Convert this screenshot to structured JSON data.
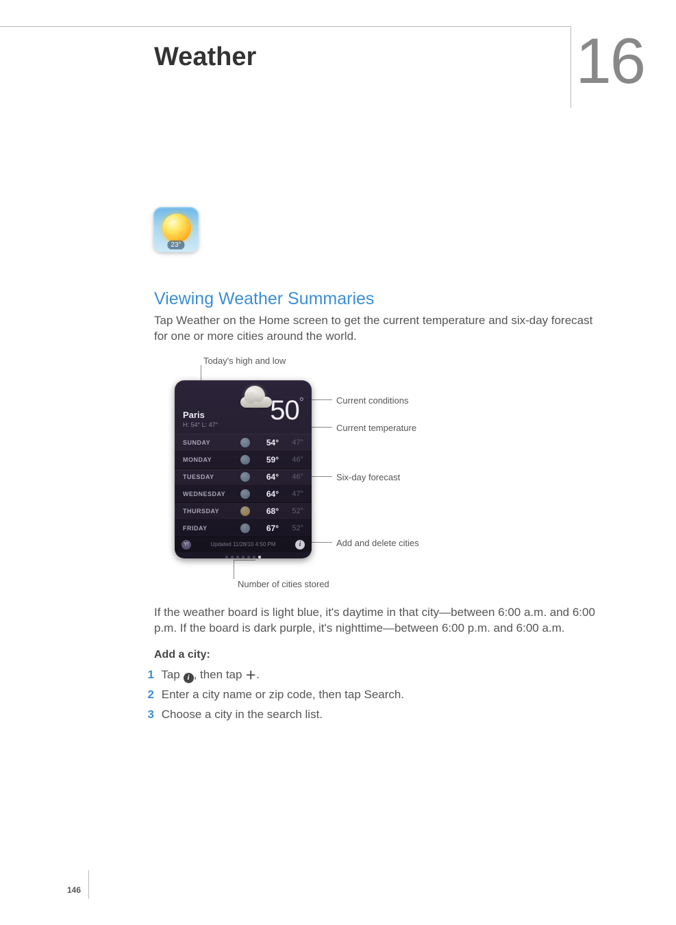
{
  "chapter": {
    "title": "Weather",
    "number": "16"
  },
  "page_number": "146",
  "app_icon": {
    "badge": "23°"
  },
  "section": {
    "heading": "Viewing Weather Summaries",
    "intro": "Tap Weather on the Home screen to get the current temperature and six-day forecast for one or more cities around the world."
  },
  "callouts": {
    "today_high_low": "Today's high and low",
    "current_conditions": "Current conditions",
    "current_temperature": "Current temperature",
    "six_day_forecast": "Six-day forecast",
    "add_delete_cities": "Add and delete cities",
    "number_of_cities": "Number of cities stored"
  },
  "widget": {
    "city": "Paris",
    "hilo": "H: 54° L: 47°",
    "current_temp": "50",
    "updated": "Updated 11/28/10 4:50 PM",
    "days": [
      {
        "name": "SUNDAY",
        "icon": "rain",
        "hi": "54°",
        "lo": "47°"
      },
      {
        "name": "MONDAY",
        "icon": "rain",
        "hi": "59°",
        "lo": "46°"
      },
      {
        "name": "TUESDAY",
        "icon": "rain",
        "hi": "64°",
        "lo": "46°"
      },
      {
        "name": "WEDNESDAY",
        "icon": "rain",
        "hi": "64°",
        "lo": "47°"
      },
      {
        "name": "THURSDAY",
        "icon": "sun",
        "hi": "68°",
        "lo": "52°"
      },
      {
        "name": "FRIDAY",
        "icon": "rain",
        "hi": "67°",
        "lo": "52°"
      }
    ],
    "dots": 7,
    "active_dot": 6
  },
  "after_figure": {
    "para": "If the weather board is light blue, it's daytime in that city—between 6:00 a.m. and 6:00 p.m. If the board is dark purple, it's nighttime—between 6:00 p.m. and 6:00 a.m.",
    "add_city_heading": "Add a city:",
    "steps": {
      "s1_a": "Tap ",
      "s1_b": ", then tap ",
      "s1_c": ".",
      "s2": "Enter a city name or zip code, then tap Search.",
      "s3": "Choose a city in the search list."
    },
    "step_numbers": {
      "n1": "1",
      "n2": "2",
      "n3": "3"
    }
  }
}
